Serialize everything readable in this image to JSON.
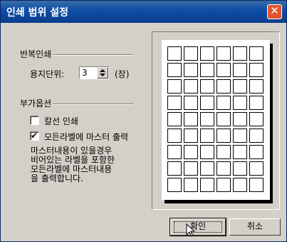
{
  "window": {
    "title": "인쇄 범위 설정",
    "close_icon": "close-icon"
  },
  "repeat_print": {
    "section_title": "반복인쇄",
    "sheet_unit_label": "용지단위:",
    "sheet_unit_value": "3",
    "sheet_unit_suffix": "(장)"
  },
  "extra_options": {
    "section_title": "부가옵션",
    "color_print": {
      "label": "칼선 인쇄",
      "checked": false
    },
    "master_output": {
      "label": "모든라벨에 마스터 출력",
      "checked": true
    },
    "description": [
      "마스터내용이 있을경우",
      "비어있는 라벨을 포함한",
      "모든라벨에 마스터내용",
      "을 출력합니다."
    ]
  },
  "preview": {
    "rows": 9,
    "cols": 6
  },
  "buttons": {
    "ok": "확인",
    "cancel": "취소"
  },
  "colors": {
    "titlebar": "#0a3c8c",
    "face": "#d4d0c8",
    "close": "#e0542f"
  }
}
